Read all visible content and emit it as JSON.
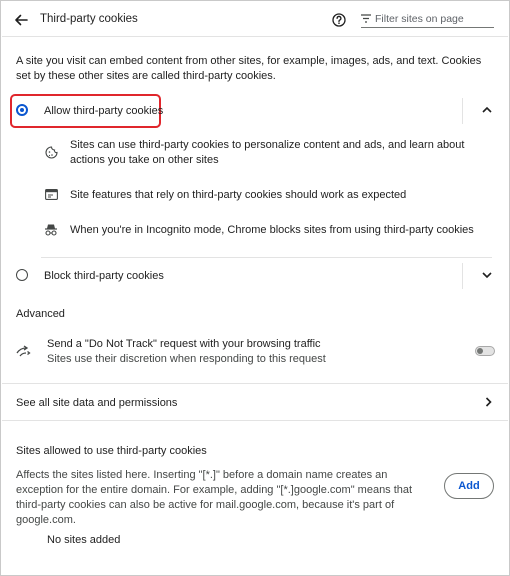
{
  "header": {
    "back_icon": "arrow-left-icon",
    "title": "Third-party cookies",
    "help_icon": "help-circle-icon",
    "filter_icon": "filter-icon",
    "filter_placeholder": "Filter sites on page"
  },
  "intro": "A site you visit can embed content from other sites, for example, images, ads, and text. Cookies set by these other sites are called third-party cookies.",
  "options": {
    "allow": {
      "label": "Allow third-party cookies",
      "selected": true,
      "expanded": true,
      "bullets": [
        {
          "icon": "cookie-icon",
          "text": "Sites can use third-party cookies to personalize content and ads, and learn about actions you take on other sites"
        },
        {
          "icon": "web-asset-icon",
          "text": "Site features that rely on third-party cookies should work as expected"
        },
        {
          "icon": "incognito-icon",
          "text": "When you're in Incognito mode, Chrome blocks sites from using third-party cookies"
        }
      ]
    },
    "block": {
      "label": "Block third-party cookies",
      "selected": false,
      "expanded": false
    }
  },
  "advanced": {
    "heading": "Advanced",
    "dnt_title": "Send a \"Do Not Track\" request with your browsing traffic",
    "dnt_subtitle": "Sites use their discretion when responding to this request",
    "dnt_enabled": false
  },
  "see_all": "See all site data and permissions",
  "allowed": {
    "heading": "Sites allowed to use third-party cookies",
    "description": "Affects the sites listed here. Inserting \"[*.]\" before a domain name creates an exception for the entire domain. For example, adding \"[*.]google.com\" means that third-party cookies can also be active for mail.google.com, because it's part of google.com.",
    "add_label": "Add",
    "empty": "No sites added"
  },
  "colors": {
    "accent": "#0b57d0",
    "highlight_border": "#e0262c",
    "toggle_off": "#a8a8a8"
  }
}
